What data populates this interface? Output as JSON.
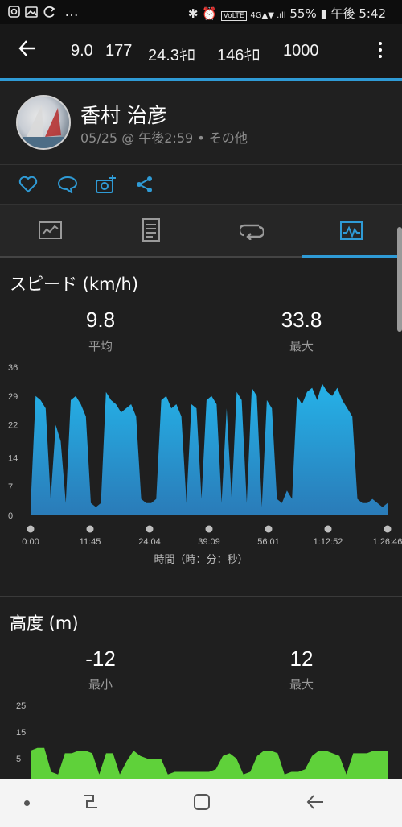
{
  "status_bar": {
    "left_icons": [
      "instagram-icon",
      "gallery-icon",
      "sync-icon",
      "more-icon"
    ],
    "left_text": "…",
    "battery": "55%",
    "time": "午後 5:42"
  },
  "header": {
    "metrics": [
      "9.0",
      "177",
      "24.3ｷﾛ",
      "146ｷﾛ",
      "1000"
    ]
  },
  "profile": {
    "name": "香村 治彦",
    "subtitle": "05/25 @ 午後2:59 • その他"
  },
  "actions": [
    "like-icon",
    "comment-icon",
    "add-photo-icon",
    "share-icon"
  ],
  "tabs": [
    {
      "name": "summary",
      "icon": "chart-card-icon"
    },
    {
      "name": "details",
      "icon": "document-icon"
    },
    {
      "name": "laps",
      "icon": "loop-icon"
    },
    {
      "name": "graphs",
      "icon": "graph-icon",
      "active": true
    }
  ],
  "speed": {
    "title": "スピード (km/h)",
    "avg_value": "9.8",
    "avg_label": "平均",
    "max_value": "33.8",
    "max_label": "最大",
    "y_ticks": [
      "36",
      "29",
      "22",
      "14",
      "7",
      "0"
    ],
    "x_ticks": [
      "0:00",
      "11:45",
      "24:04",
      "39:09",
      "56:01",
      "1:12:52",
      "1:26:46"
    ],
    "x_axis_label": "時間（時：分：秒）"
  },
  "altitude": {
    "title": "高度 (m)",
    "min_value": "-12",
    "min_label": "最小",
    "max_value": "12",
    "max_label": "最大",
    "y_ticks": [
      "25",
      "15",
      "5"
    ]
  },
  "colors": {
    "accent": "#2f9bd6",
    "speed_fill": "#2aa7dc",
    "altitude_fill": "#5fd13a",
    "background": "#1f1f1f"
  },
  "chart_data": [
    {
      "type": "area",
      "title": "スピード (km/h)",
      "xlabel": "時間（時：分：秒）",
      "ylabel": "",
      "ylim": [
        0,
        36
      ],
      "x_ticks": [
        "0:00",
        "11:45",
        "24:04",
        "39:09",
        "56:01",
        "1:12:52",
        "1:26:46"
      ],
      "x_minutes": [
        0,
        1,
        2,
        3,
        4,
        5,
        6,
        7,
        8,
        9,
        10,
        11,
        12,
        13,
        14,
        15,
        16,
        17,
        18,
        19,
        20,
        21,
        22,
        23,
        24,
        25,
        26,
        27,
        28,
        29,
        30,
        31,
        32,
        33,
        34,
        35,
        36,
        37,
        38,
        39,
        40,
        41,
        42,
        43,
        44,
        45,
        46,
        47,
        48,
        49,
        50,
        51,
        52,
        53,
        54,
        55,
        56,
        57,
        58,
        59,
        60,
        61,
        62,
        63,
        64,
        65,
        66,
        67,
        68,
        69,
        70,
        71,
        72,
        73,
        74,
        75,
        76,
        77,
        78,
        79,
        80,
        81,
        82,
        83,
        84,
        85,
        86,
        87
      ],
      "values": [
        2,
        29,
        28,
        26,
        4,
        22,
        18,
        3,
        28,
        29,
        27,
        24,
        3,
        2,
        3,
        30,
        28,
        27,
        25,
        26,
        27,
        24,
        4,
        3,
        3,
        4,
        28,
        29,
        26,
        27,
        24,
        3,
        27,
        26,
        4,
        28,
        29,
        27,
        3,
        26,
        4,
        30,
        28,
        3,
        31,
        29,
        2,
        28,
        26,
        4,
        3,
        6,
        4,
        29,
        27,
        30,
        31,
        28,
        32,
        30,
        29,
        31,
        28,
        26,
        24,
        4,
        3,
        3,
        4,
        3,
        2,
        3
      ]
    },
    {
      "type": "area",
      "title": "高度 (m)",
      "xlabel": "",
      "ylabel": "",
      "ylim": [
        -15,
        25
      ],
      "values": [
        8,
        9,
        9,
        0,
        -1,
        7,
        7,
        8,
        8,
        7,
        -1,
        7,
        7,
        -1,
        4,
        8,
        6,
        5,
        5,
        5,
        -1,
        0,
        0,
        0,
        0,
        0,
        0,
        1,
        6,
        7,
        5,
        -1,
        0,
        6,
        8,
        8,
        7,
        -1,
        0,
        0,
        1,
        6,
        8,
        8,
        7,
        6,
        -1,
        7,
        7,
        7,
        8,
        8,
        8
      ]
    }
  ],
  "navbar": {
    "buttons": [
      "dot-icon",
      "recents-icon",
      "home-icon",
      "back-icon"
    ]
  }
}
